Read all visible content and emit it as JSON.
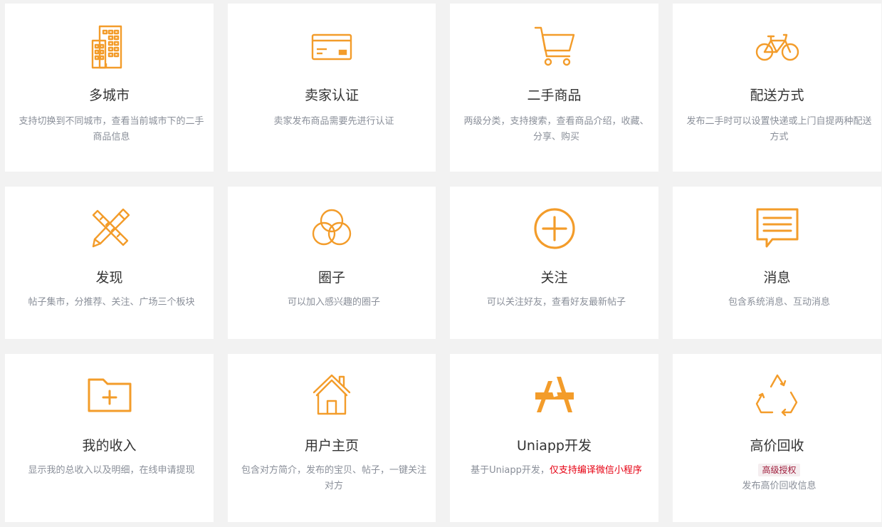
{
  "features": [
    {
      "icon": "buildings-icon",
      "title": "多城市",
      "desc": "支持切换到不同城市，查看当前城市下的二手商品信息"
    },
    {
      "icon": "credit-card-icon",
      "title": "卖家认证",
      "desc": "卖家发布商品需要先进行认证"
    },
    {
      "icon": "shopping-cart-icon",
      "title": "二手商品",
      "desc": "两级分类，支持搜索，查看商品介绍，收藏、分享、购买"
    },
    {
      "icon": "bicycle-icon",
      "title": "配送方式",
      "desc": "发布二手时可以设置快递或上门自提两种配送方式"
    },
    {
      "icon": "pencil-ruler-icon",
      "title": "发现",
      "desc": "帖子集市，分推荐、关注、广场三个板块"
    },
    {
      "icon": "venn-circles-icon",
      "title": "圈子",
      "desc": "可以加入感兴趣的圈子"
    },
    {
      "icon": "plus-circle-icon",
      "title": "关注",
      "desc": "可以关注好友，查看好友最新帖子"
    },
    {
      "icon": "chat-message-icon",
      "title": "消息",
      "desc": "包含系统消息、互动消息"
    },
    {
      "icon": "folder-add-icon",
      "title": "我的收入",
      "desc": "显示我的总收入以及明细，在线申请提现"
    },
    {
      "icon": "home-icon",
      "title": "用户主页",
      "desc": "包含对方简介，发布的宝贝、帖子，一键关注对方"
    },
    {
      "icon": "app-store-icon",
      "title": "Uniapp开发",
      "desc": "基于Uniapp开发，",
      "desc_highlight": "仅支持编译微信小程序"
    },
    {
      "icon": "recycle-icon",
      "title": "高价回收",
      "badge": "高级授权",
      "desc": "发布高价回收信息"
    }
  ],
  "colors": {
    "accent": "#f39c2a",
    "title": "#333333",
    "desc": "#8a8f99",
    "highlight": "#e60012"
  }
}
